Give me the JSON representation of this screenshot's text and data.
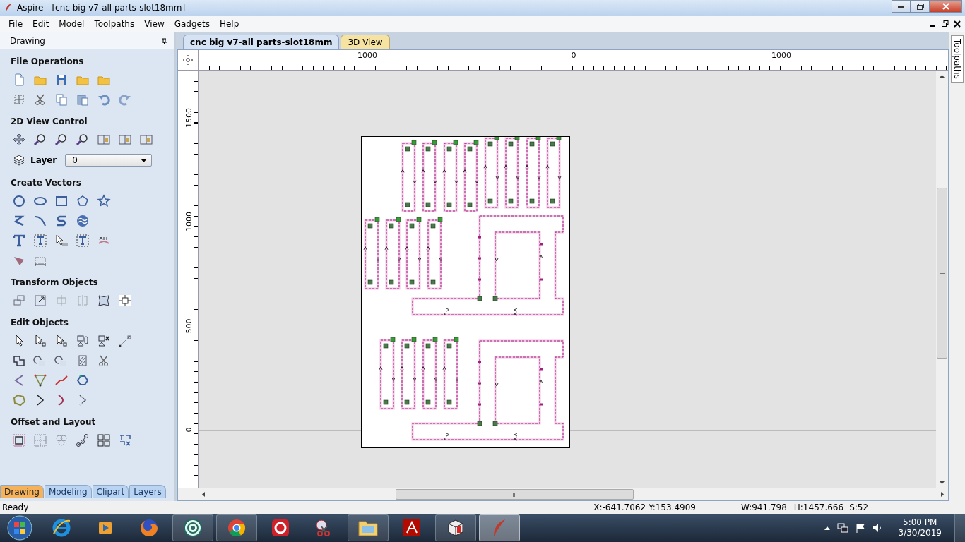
{
  "window": {
    "title": "Aspire - [cnc big v7-all parts-slot18mm]"
  },
  "menu": [
    "File",
    "Edit",
    "Model",
    "Toolpaths",
    "View",
    "Gadgets",
    "Help"
  ],
  "panel": {
    "title": "Drawing",
    "sections": [
      {
        "title": "File Operations"
      },
      {
        "title": "2D View Control",
        "layer": {
          "label": "Layer",
          "value": "0"
        }
      },
      {
        "title": "Create Vectors"
      },
      {
        "title": "Transform Objects"
      },
      {
        "title": "Edit Objects"
      },
      {
        "title": "Offset and Layout"
      }
    ],
    "tabs": [
      {
        "label": "Drawing",
        "selected": true
      },
      {
        "label": "Modeling",
        "selected": false
      },
      {
        "label": "Clipart",
        "selected": false
      },
      {
        "label": "Layers",
        "selected": false
      }
    ]
  },
  "document_tabs": [
    {
      "label": "cnc big v7-all parts-slot18mm",
      "selected": true
    },
    {
      "label": "3D View",
      "selected": false
    }
  ],
  "rulers": {
    "horizontal": [
      "-1000",
      "0",
      "1000"
    ],
    "vertical": [
      "1500",
      "1000",
      "500",
      "0"
    ]
  },
  "side_tab": "Toolpaths",
  "status_bar": {
    "message": "Ready",
    "cursor": "X:-641.7062 Y:153.4909",
    "width": "W:941.798",
    "height": "H:1457.666",
    "scale": "S:52"
  },
  "taskbar": {
    "time": "5:00 PM",
    "date": "3/30/2019"
  }
}
